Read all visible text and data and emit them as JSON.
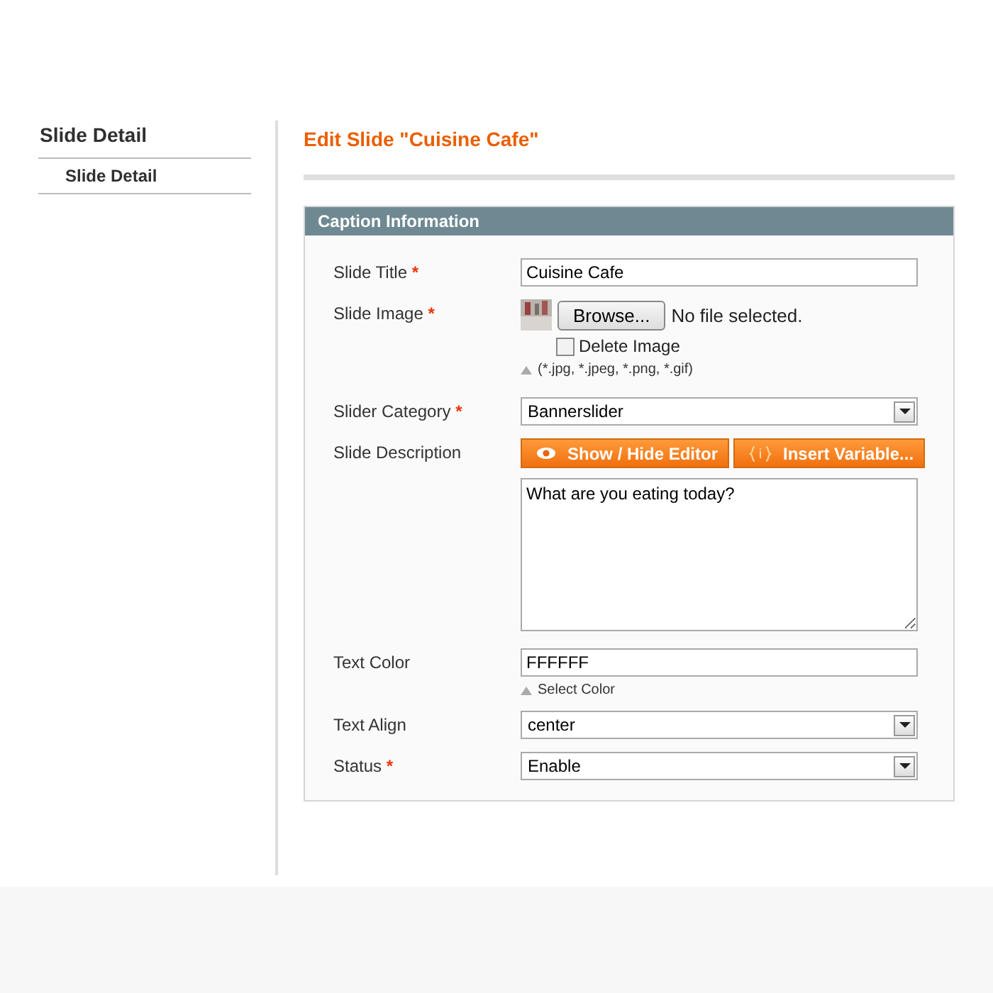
{
  "sidebar": {
    "title": "Slide Detail",
    "items": [
      {
        "label": "Slide Detail",
        "selected": true
      }
    ]
  },
  "page_title": "Edit Slide \"Cuisine Cafe\"",
  "required_mark": "*",
  "fieldset": {
    "title": "Caption Information",
    "fields": [
      {
        "kind": "text",
        "label": "Slide Title",
        "required": true,
        "value": "Cuisine Cafe"
      },
      {
        "label": "Slide Image",
        "required": true,
        "button": "Browse...",
        "file_status": "No file selected.",
        "delete_label": "Delete Image",
        "delete_checked": false,
        "note": "(*.jpg, *.jpeg, *.png, *.gif)"
      },
      {
        "kind": "select",
        "label": "Slider Category",
        "required": true,
        "value": "Bannerslider"
      },
      {
        "kind": "editor",
        "label": "Slide Description",
        "required": false,
        "buttons": [
          "Show / Hide Editor",
          "Insert Variable..."
        ],
        "value": "What are you eating today?"
      },
      {
        "kind": "color",
        "label": "Text Color",
        "required": false,
        "value": "FFFFFF",
        "note": "Select Color"
      },
      {
        "kind": "select",
        "label": "Text Align",
        "required": false,
        "value": "center"
      },
      {
        "kind": "select",
        "label": "Status",
        "required": true,
        "value": "Enable"
      }
    ]
  }
}
